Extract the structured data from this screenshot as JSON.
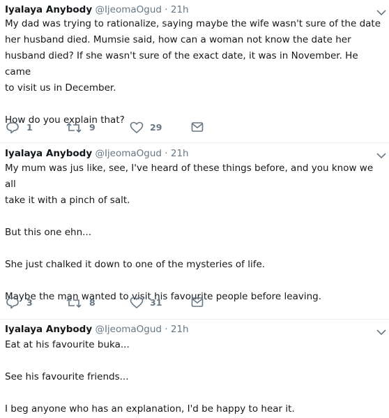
{
  "tweets": [
    {
      "author_name": "Iyalaya Anybody",
      "author_handle": "@IjeomaOgud",
      "separator": "·",
      "time": "21h",
      "paragraphs": [
        "My dad was trying to rationalize, saying maybe the wife wasn't sure of the date\nher husband died. Mumsie said, how can a woman not know the date her\nhusband died? If she wasn't sure of the exact date, it was in November. He came\nto visit us in December.",
        "How do you explain that?"
      ],
      "replies": "1",
      "retweets": "9",
      "likes": "29"
    },
    {
      "author_name": "Iyalaya Anybody",
      "author_handle": "@IjeomaOgud",
      "separator": "·",
      "time": "21h",
      "paragraphs": [
        "My mum was jus like, see, I've heard of these things before, and you know we all\ntake it with a pinch of salt.",
        "But this one ehn...",
        "She just chalked it down to one of the mysteries of life.",
        "Maybe the man wanted to visit his favourite people before leaving."
      ],
      "replies": "3",
      "retweets": "8",
      "likes": "31"
    },
    {
      "author_name": "Iyalaya Anybody",
      "author_handle": "@IjeomaOgud",
      "separator": "·",
      "time": "21h",
      "paragraphs": [
        "Eat at his favourite buka...",
        "See his favourite friends...",
        "I beg anyone who has an explanation, I'd be happy to hear it."
      ]
    }
  ],
  "icons": {
    "reply": "reply-icon",
    "retweet": "retweet-icon",
    "like": "heart-icon",
    "message": "envelope-icon",
    "caret": "chevron-down-icon"
  },
  "colors": {
    "text": "#14171a",
    "muted": "#657786",
    "icon": "#657786",
    "divider": "#e6ecf0"
  }
}
